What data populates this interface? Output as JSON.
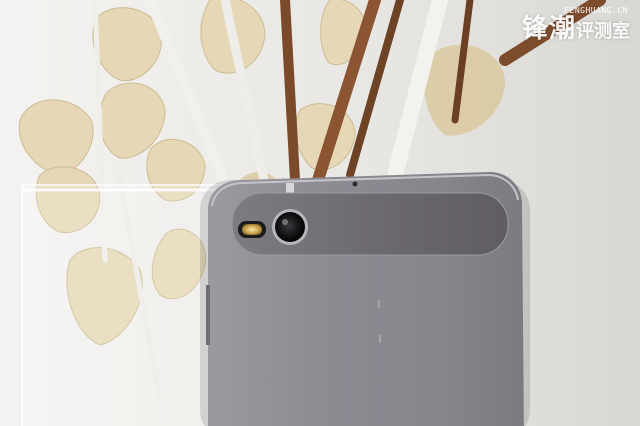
{
  "photo": {
    "subject": "smartphone-rear",
    "colors": {
      "background": "#e9e7e3",
      "phone_body": "#8b8a90",
      "camera_strip": "#6f6c72",
      "petals": "#e6d8b6",
      "twigs": "#7a4a2a",
      "white_sticks": "#f2f0ec"
    }
  },
  "watermark": {
    "brand": "锋潮",
    "sub": "评测室",
    "url": "FENGHUANG.CN"
  }
}
